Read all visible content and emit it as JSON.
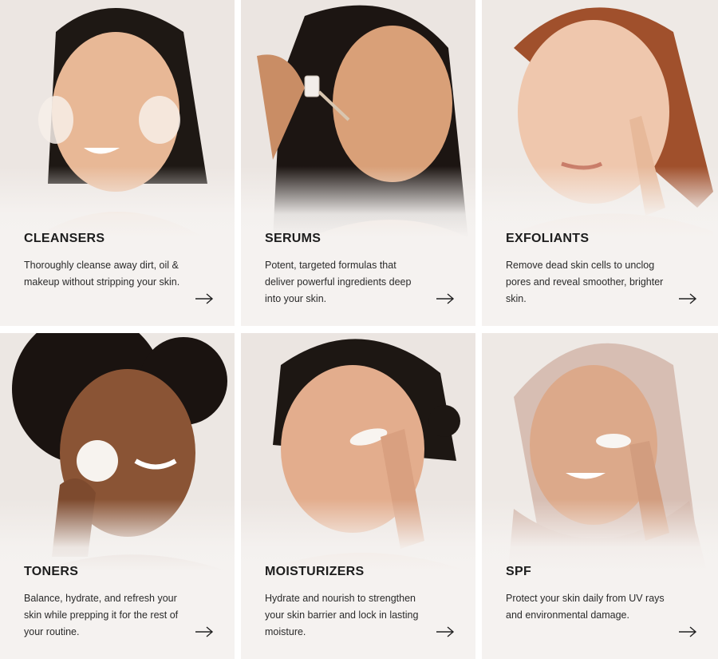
{
  "cards": [
    {
      "title": "CLEANSERS",
      "description": "Thoroughly cleanse away dirt, oil & makeup without stripping your skin.",
      "icon": "arrow-right-icon",
      "skin": "#e8b896",
      "hair": "#1e1814"
    },
    {
      "title": "SERUMS",
      "description": "Potent, targeted formulas that deliver powerful ingredients deep into your skin.",
      "icon": "arrow-right-icon",
      "skin": "#d9a078",
      "hair": "#1c1512"
    },
    {
      "title": "EXFOLIANTS",
      "description": "Remove dead skin cells to unclog pores and reveal smoother, brighter skin.",
      "icon": "arrow-right-icon",
      "skin": "#efc7ad",
      "hair": "#a0502c"
    },
    {
      "title": "TONERS",
      "description": "Balance, hydrate, and refresh your skin while prepping it for the rest of your routine.",
      "icon": "arrow-right-icon",
      "skin": "#8a5435",
      "hair": "#1a1310"
    },
    {
      "title": "MOISTURIZERS",
      "description": "Hydrate and nourish to strengthen your skin barrier and lock in lasting moisture.",
      "icon": "arrow-right-icon",
      "skin": "#e3ad8d",
      "hair": "#1d1713"
    },
    {
      "title": "SPF",
      "description": "Protect your skin daily from UV rays and environmental damage.",
      "icon": "arrow-right-icon",
      "skin": "#dca98a",
      "hair": "#d7beb3"
    }
  ]
}
